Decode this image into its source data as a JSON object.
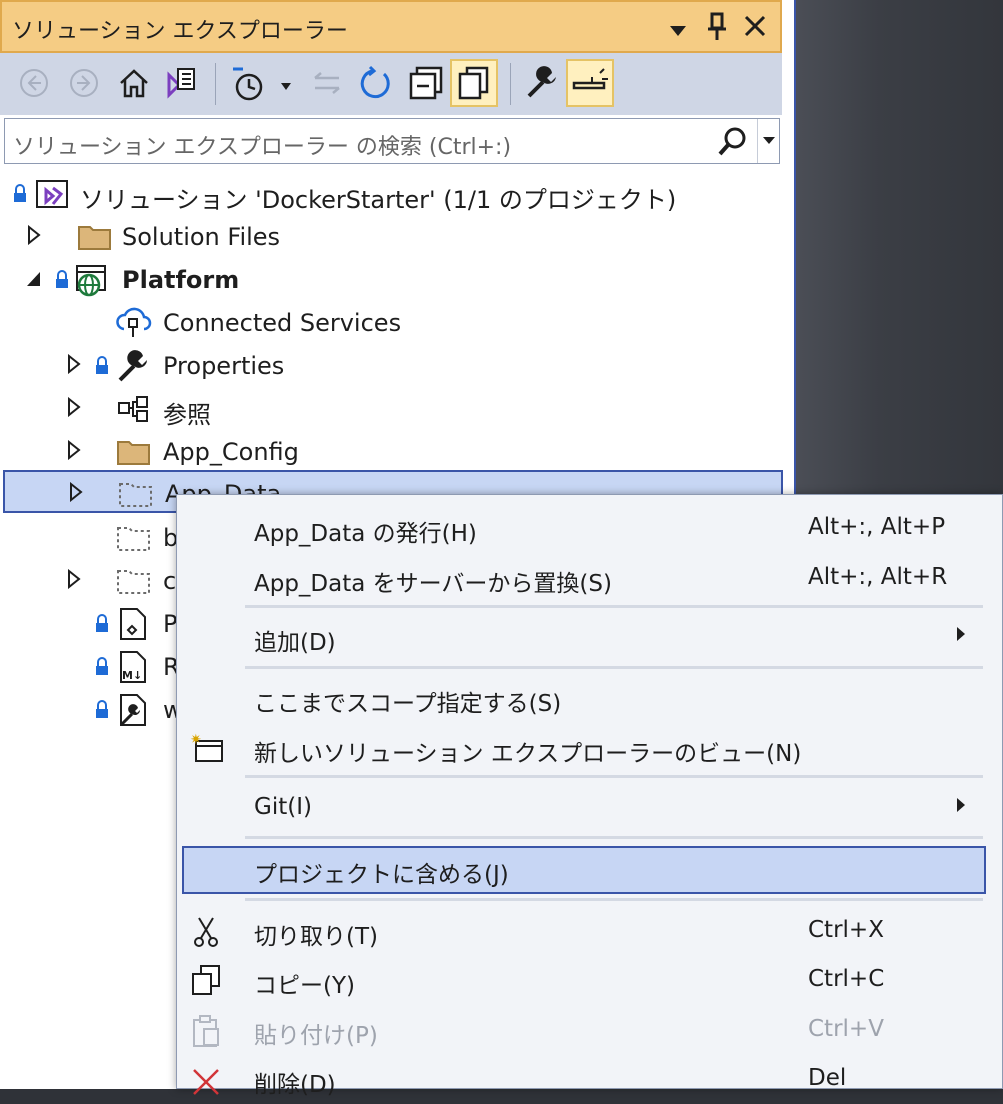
{
  "window": {
    "title": "ソリューション エクスプローラー",
    "controls": [
      "dropdown-icon",
      "pin-icon",
      "close-icon"
    ]
  },
  "toolbar": {
    "buttons": [
      "back-icon",
      "forward-icon",
      "home-icon",
      "switch-views-icon",
      "pending-changes-filter-icon",
      "sync-icon",
      "refresh-icon",
      "collapse-all-icon",
      "show-all-files-icon",
      "properties-icon",
      "preview-icon"
    ]
  },
  "search": {
    "placeholder": "ソリューション エクスプローラー の検索 (Ctrl+:)"
  },
  "tree": {
    "solution": "ソリューション 'DockerStarter' (1/1 のプロジェクト)",
    "items": [
      {
        "label": "Solution Files"
      },
      {
        "label": "Platform"
      },
      {
        "label": "Connected Services"
      },
      {
        "label": "Properties"
      },
      {
        "label": "参照"
      },
      {
        "label": "App_Config"
      },
      {
        "label": "App_Data"
      },
      {
        "label": "b"
      },
      {
        "label": "c"
      },
      {
        "label": "P"
      },
      {
        "label": "R"
      },
      {
        "label": "w"
      }
    ]
  },
  "context_menu": {
    "items": [
      {
        "label": "App_Data の発行(H)",
        "shortcut": "Alt+:, Alt+P"
      },
      {
        "label": "App_Data をサーバーから置換(S)",
        "shortcut": "Alt+:, Alt+R"
      },
      {
        "label": "追加(D)",
        "shortcut": ""
      },
      {
        "label": "ここまでスコープ指定する(S)",
        "shortcut": ""
      },
      {
        "label": "新しいソリューション エクスプローラーのビュー(N)",
        "shortcut": ""
      },
      {
        "label": "Git(I)",
        "shortcut": ""
      },
      {
        "label": "プロジェクトに含める(J)",
        "shortcut": ""
      },
      {
        "label": "切り取り(T)",
        "shortcut": "Ctrl+X"
      },
      {
        "label": "コピー(Y)",
        "shortcut": "Ctrl+C"
      },
      {
        "label": "貼り付け(P)",
        "shortcut": "Ctrl+V"
      },
      {
        "label": "削除(D)",
        "shortcut": "Del"
      }
    ]
  },
  "colors": {
    "title_bg": "#f5cc84",
    "toolbar_bg": "#cfd6e5",
    "selection_bg": "#c7d6f4",
    "selection_border": "#3a55a8",
    "menu_bg": "#f2f4f8"
  }
}
